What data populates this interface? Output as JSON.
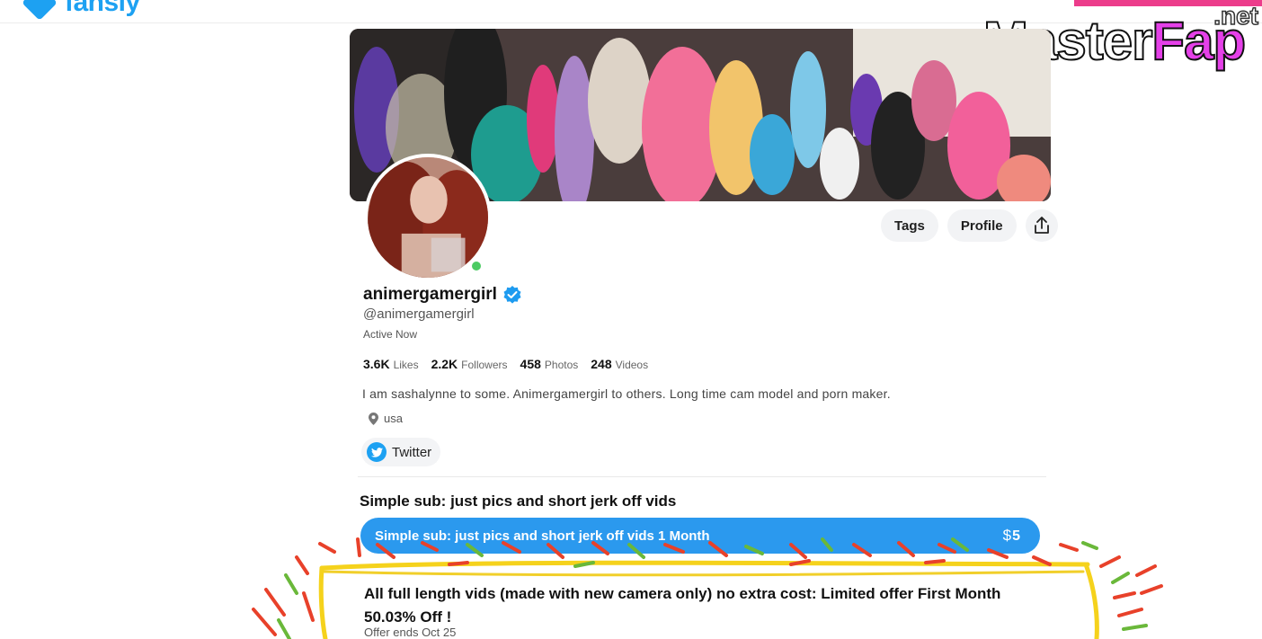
{
  "site": {
    "logo_text": "fansly"
  },
  "watermark": {
    "brand_main": "Master",
    "brand_accent": "Fap",
    "brand_tld": ".net"
  },
  "profile": {
    "display_name": "animergamergirl",
    "handle": "@animergamergirl",
    "status": "Active Now",
    "verified": true,
    "online": true,
    "stats": [
      {
        "value": "3.6K",
        "label": "Likes"
      },
      {
        "value": "2.2K",
        "label": "Followers"
      },
      {
        "value": "458",
        "label": "Photos"
      },
      {
        "value": "248",
        "label": "Videos"
      }
    ],
    "bio": "I am sashalynne to some. Animergamergirl to others. Long time cam model and porn maker.",
    "location": "usa",
    "social": {
      "twitter_label": "Twitter"
    }
  },
  "actions": {
    "tags_label": "Tags",
    "profile_label": "Profile"
  },
  "subscription": {
    "tier_title": "Simple sub: just pics and short jerk off vids",
    "plan_label": "Simple sub: just pics and short jerk off vids 1 Month",
    "price_symbol": "$",
    "price_value": "5"
  },
  "offer": {
    "title": "All full length vids (made with new camera only) no extra cost: Limited offer First Month 50.03% Off !",
    "ends": "Offer ends Oct 25"
  },
  "colors": {
    "brand_blue": "#1da1f2",
    "tier_bar": "#2b99ee",
    "online_green": "#4ccb63",
    "annotation_yellow": "#f5d21c"
  }
}
